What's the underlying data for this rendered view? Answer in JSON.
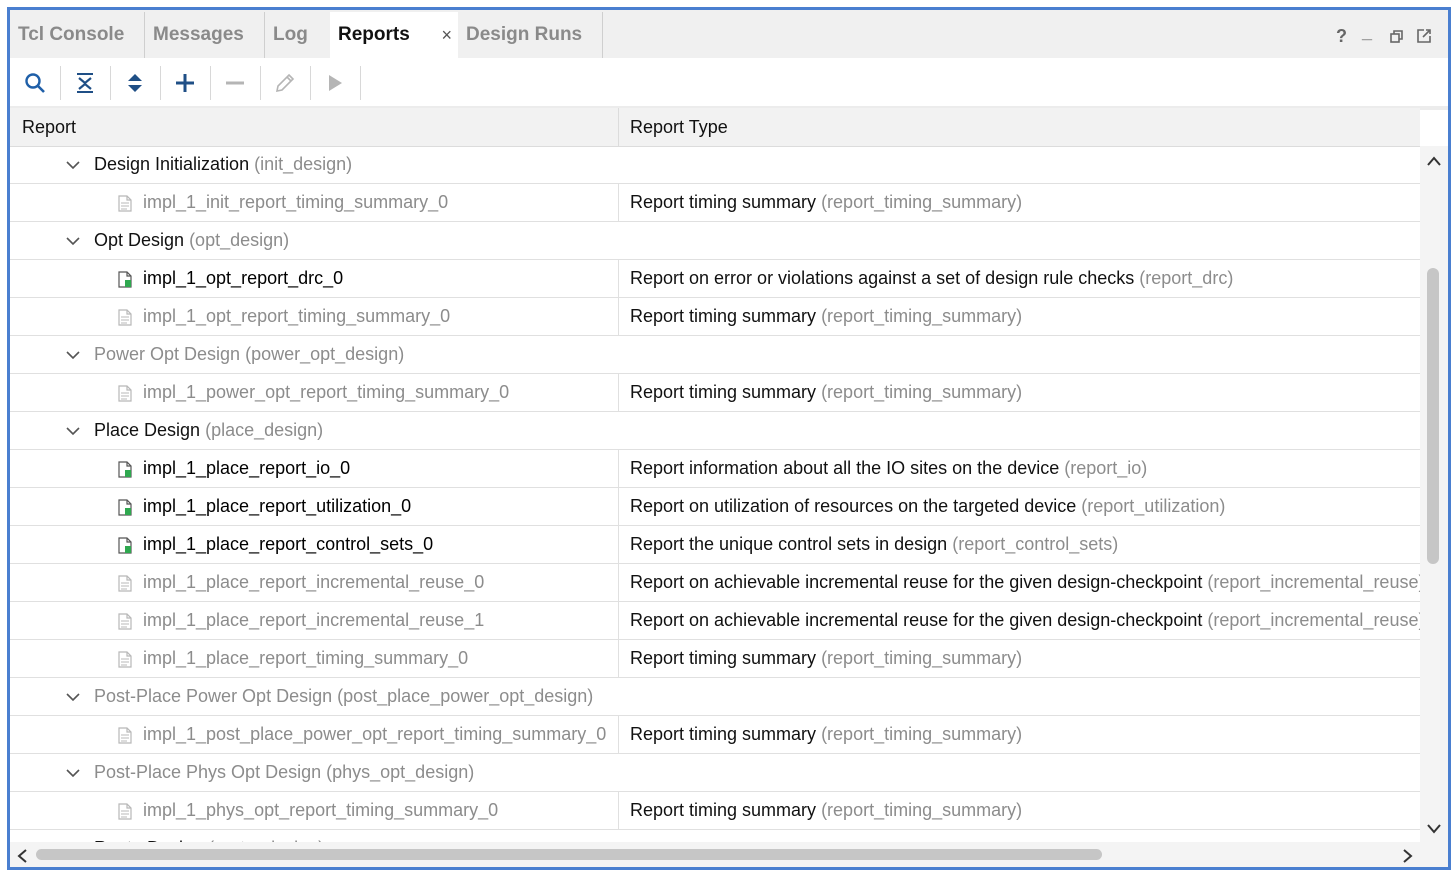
{
  "tabs": [
    {
      "label": "Tcl Console"
    },
    {
      "label": "Messages"
    },
    {
      "label": "Log"
    },
    {
      "label": "Reports",
      "close": "×"
    },
    {
      "label": "Design Runs"
    }
  ],
  "window_controls": {
    "help": "?",
    "minimize": "_"
  },
  "toolbar": {
    "icons": [
      "search-icon",
      "collapse-all-icon",
      "expand-all-icon",
      "add-icon",
      "remove-icon",
      "edit-icon",
      "run-icon"
    ]
  },
  "columns": {
    "report": "Report",
    "report_type": "Report Type"
  },
  "rows": [
    {
      "type": "group",
      "name": "Design Initialization",
      "cmd": "(init_design)",
      "dim": false
    },
    {
      "type": "report",
      "name": "impl_1_init_report_timing_summary_0",
      "available": false,
      "desc": "Report timing summary",
      "cmd": "(report_timing_summary)"
    },
    {
      "type": "group",
      "name": "Opt Design",
      "cmd": "(opt_design)",
      "dim": false
    },
    {
      "type": "report",
      "name": "impl_1_opt_report_drc_0",
      "available": true,
      "desc": "Report on error or violations against a set of design rule checks",
      "cmd": "(report_drc)"
    },
    {
      "type": "report",
      "name": "impl_1_opt_report_timing_summary_0",
      "available": false,
      "desc": "Report timing summary",
      "cmd": "(report_timing_summary)"
    },
    {
      "type": "group",
      "name": "Power Opt Design",
      "cmd": "(power_opt_design)",
      "dim": true
    },
    {
      "type": "report",
      "name": "impl_1_power_opt_report_timing_summary_0",
      "available": false,
      "desc": "Report timing summary",
      "cmd": "(report_timing_summary)"
    },
    {
      "type": "group",
      "name": "Place Design",
      "cmd": "(place_design)",
      "dim": false
    },
    {
      "type": "report",
      "name": "impl_1_place_report_io_0",
      "available": true,
      "desc": "Report information about all the IO sites on the device",
      "cmd": "(report_io)"
    },
    {
      "type": "report",
      "name": "impl_1_place_report_utilization_0",
      "available": true,
      "desc": "Report on utilization of resources on the targeted device",
      "cmd": "(report_utilization)"
    },
    {
      "type": "report",
      "name": "impl_1_place_report_control_sets_0",
      "available": true,
      "desc": "Report the unique control sets in design",
      "cmd": "(report_control_sets)"
    },
    {
      "type": "report",
      "name": "impl_1_place_report_incremental_reuse_0",
      "available": false,
      "desc": "Report on achievable incremental reuse for the given design-checkpoint",
      "cmd": "(report_incremental_reuse)"
    },
    {
      "type": "report",
      "name": "impl_1_place_report_incremental_reuse_1",
      "available": false,
      "desc": "Report on achievable incremental reuse for the given design-checkpoint",
      "cmd": "(report_incremental_reuse)"
    },
    {
      "type": "report",
      "name": "impl_1_place_report_timing_summary_0",
      "available": false,
      "desc": "Report timing summary",
      "cmd": "(report_timing_summary)"
    },
    {
      "type": "group",
      "name": "Post-Place Power Opt Design",
      "cmd": "(post_place_power_opt_design)",
      "dim": true
    },
    {
      "type": "report",
      "name": "impl_1_post_place_power_opt_report_timing_summary_0",
      "available": false,
      "desc": "Report timing summary",
      "cmd": "(report_timing_summary)"
    },
    {
      "type": "group",
      "name": "Post-Place Phys Opt Design",
      "cmd": "(phys_opt_design)",
      "dim": true
    },
    {
      "type": "report",
      "name": "impl_1_phys_opt_report_timing_summary_0",
      "available": false,
      "desc": "Report timing summary",
      "cmd": "(report_timing_summary)"
    },
    {
      "type": "group",
      "name": "Route Design",
      "cmd": "(route_design)",
      "dim": false
    }
  ],
  "colors": {
    "accent_border": "#4a7fd0",
    "available_icon": "#2fa84f",
    "dim_text": "#8c8c8c"
  }
}
